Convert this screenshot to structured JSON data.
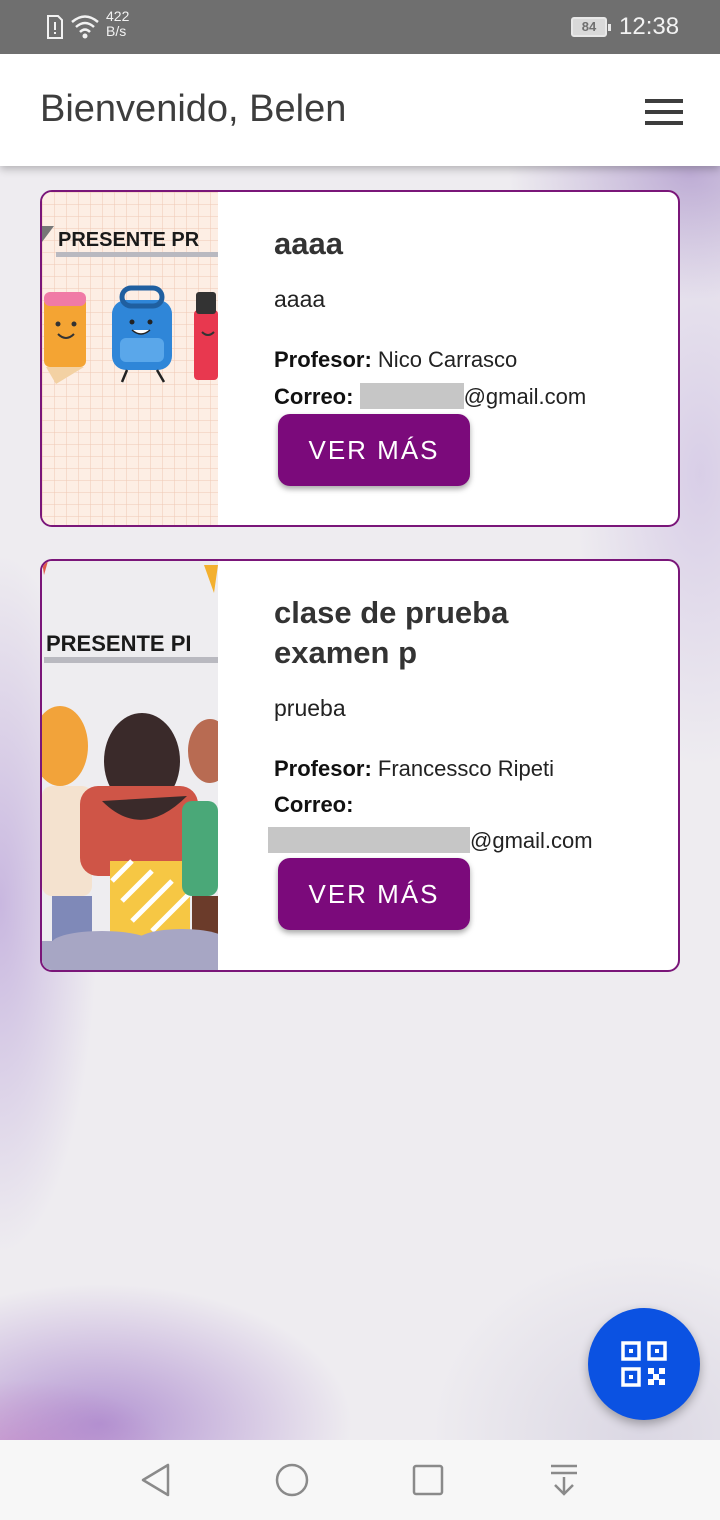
{
  "status_bar": {
    "net_speed_value": "422",
    "net_speed_unit": "B/s",
    "battery": "84",
    "time": "12:38"
  },
  "header": {
    "title": "Bienvenido, Belen",
    "menu_icon": "hamburger-menu-icon"
  },
  "classes": [
    {
      "title": "aaaa",
      "description": "aaaa",
      "profesor_label": "Profesor:",
      "profesor": "Nico Carrasco",
      "correo_label": "Correo:",
      "correo_suffix": "@gmail.com",
      "button_label": "VER MÁS",
      "image_caption": "PRESENTE PR"
    },
    {
      "title": "clase de prueba examen p",
      "description": "prueba",
      "profesor_label": "Profesor:",
      "profesor": "Francessco Ripeti",
      "correo_label": "Correo:",
      "correo_suffix": "@gmail.com",
      "button_label": "VER MÁS",
      "image_caption": "PRESENTE PI"
    }
  ],
  "fab": {
    "icon": "qr-code-icon"
  },
  "nav_bar": {
    "icons": [
      "back-icon",
      "home-icon",
      "recents-icon",
      "notification-pull-icon"
    ]
  },
  "colors": {
    "accent": "#7b0a7b",
    "card_border": "#7a1679",
    "fab": "#0b52e2",
    "status_bar": "#6f6f6f"
  }
}
